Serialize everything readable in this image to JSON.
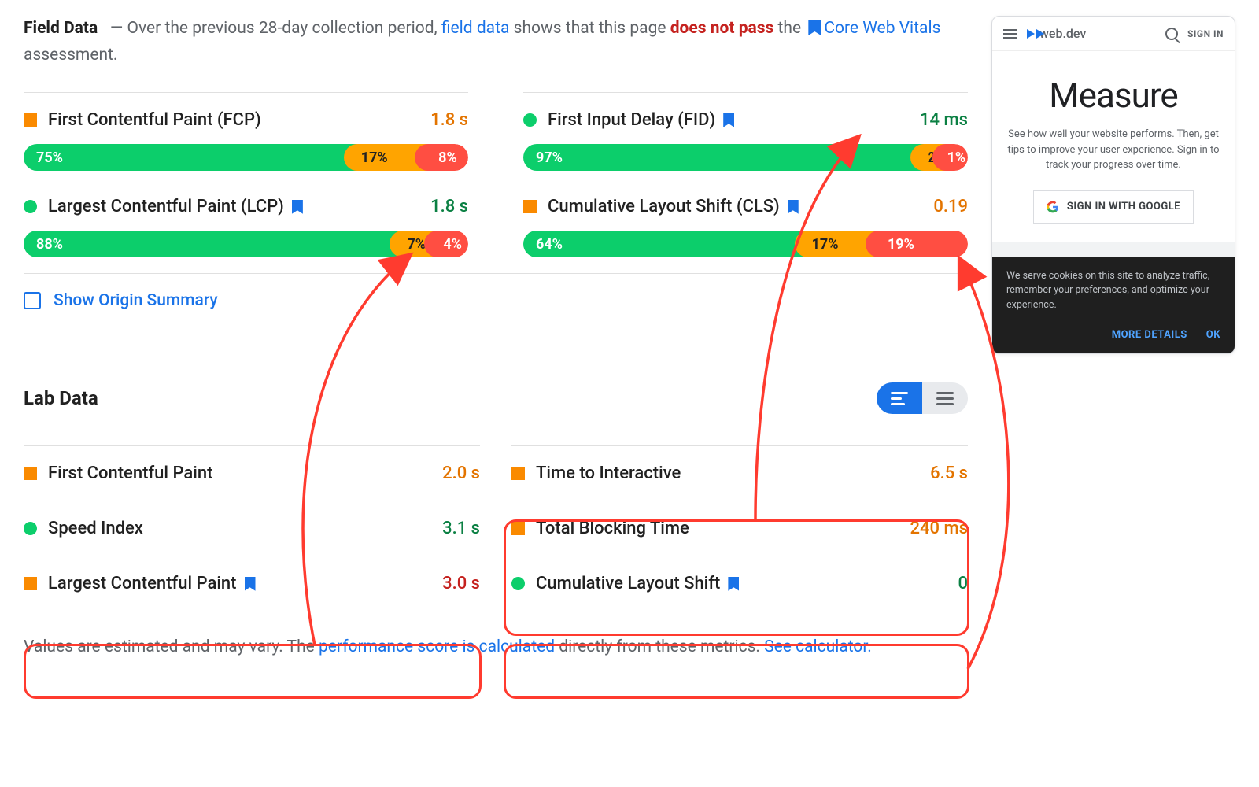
{
  "header": {
    "title": "Field Data",
    "dash": "—",
    "text1": "Over the previous 28-day collection period, ",
    "link_field_data": "field data",
    "text2": " shows that this page ",
    "fail_text": "does not pass",
    "text3": " the ",
    "link_cwv": "Core Web Vitals",
    "text4": " assessment."
  },
  "field_metrics": {
    "fcp": {
      "name": "First Contentful Paint (FCP)",
      "value": "1.8 s",
      "dist": {
        "g": "75%",
        "o": "17%",
        "r": "8%"
      }
    },
    "fid": {
      "name": "First Input Delay (FID)",
      "value": "14 ms",
      "dist": {
        "g": "97%",
        "o": "2%",
        "r": "1%"
      }
    },
    "lcp": {
      "name": "Largest Contentful Paint (LCP)",
      "value": "1.8 s",
      "dist": {
        "g": "88%",
        "o": "7%",
        "r": "4%"
      }
    },
    "cls": {
      "name": "Cumulative Layout Shift (CLS)",
      "value": "0.19",
      "dist": {
        "g": "64%",
        "o": "17%",
        "r": "19%"
      }
    }
  },
  "origin_summary": "Show Origin Summary",
  "lab": {
    "title": "Lab Data",
    "metrics": {
      "fcp": {
        "name": "First Contentful Paint",
        "value": "2.0 s"
      },
      "si": {
        "name": "Speed Index",
        "value": "3.1 s"
      },
      "lcp": {
        "name": "Largest Contentful Paint",
        "value": "3.0 s"
      },
      "tti": {
        "name": "Time to Interactive",
        "value": "6.5 s"
      },
      "tbt": {
        "name": "Total Blocking Time",
        "value": "240 ms"
      },
      "cls": {
        "name": "Cumulative Layout Shift",
        "value": "0"
      }
    }
  },
  "footnote": {
    "t1": "Values are estimated and may vary. The ",
    "link1": "performance score is calculated",
    "t2": " directly from these metrics. ",
    "link2": "See calculator."
  },
  "phone": {
    "brand": "web.dev",
    "signin": "SIGN IN",
    "title": "Measure",
    "desc": "See how well your website performs. Then, get tips to improve your user experience. Sign in to track your progress over time.",
    "gbtn": "SIGN IN WITH GOOGLE",
    "cookie": "We serve cookies on this site to analyze traffic, remember your preferences, and optimize your experience.",
    "more": "MORE DETAILS",
    "ok": "OK"
  },
  "colors": {
    "green": "#0cce6b",
    "orange": "#ffa400",
    "red": "#ff4e42",
    "blue": "#1a73e8"
  }
}
